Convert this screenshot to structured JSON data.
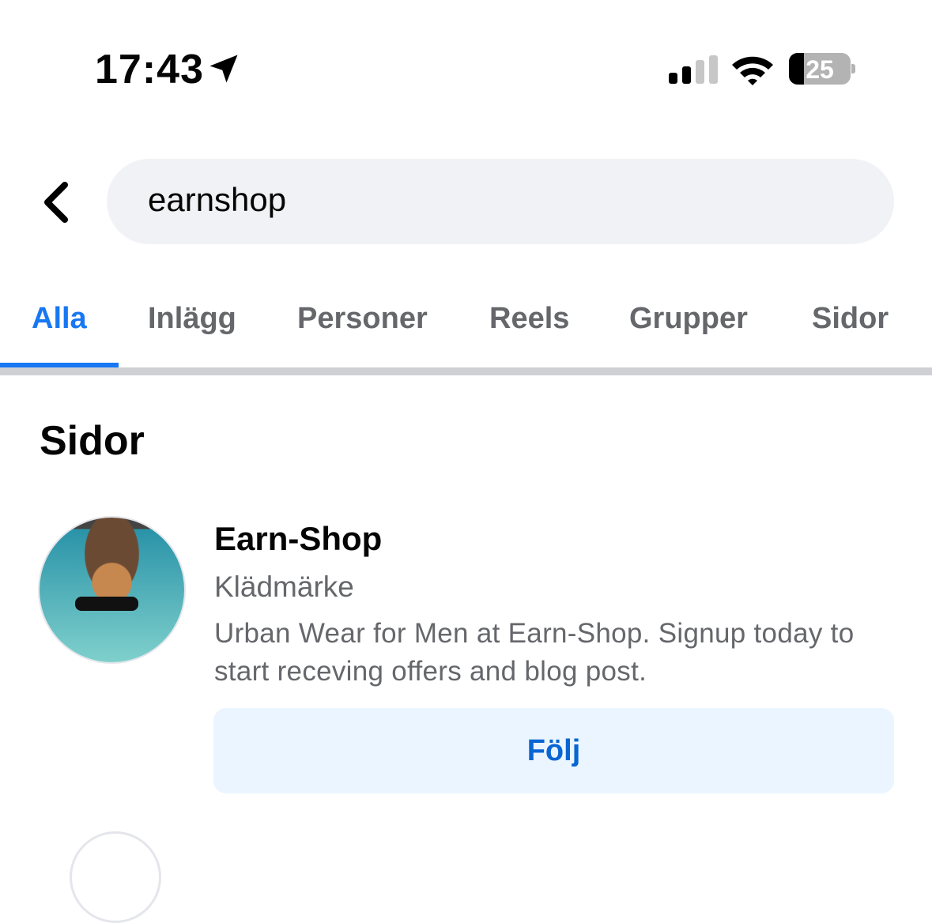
{
  "status_bar": {
    "time": "17:43",
    "battery": "25",
    "icons": [
      "location-arrow-icon",
      "signal-icon",
      "wifi-icon",
      "battery-icon"
    ]
  },
  "search": {
    "value": "earnshop"
  },
  "tabs": [
    {
      "label": "Alla",
      "active": true
    },
    {
      "label": "Inlägg"
    },
    {
      "label": "Personer"
    },
    {
      "label": "Reels"
    },
    {
      "label": "Grupper"
    },
    {
      "label": "Sidor"
    }
  ],
  "section": {
    "title": "Sidor"
  },
  "results": [
    {
      "name": "Earn-Shop",
      "category": "Klädmärke",
      "description": "Urban Wear for Men at Earn-Shop. Signup today to start receving offers and blog post.",
      "button_label": "Följ"
    }
  ],
  "colors": {
    "accent": "#1877f2",
    "button_bg": "#ebf5ff",
    "muted": "#65676b"
  }
}
